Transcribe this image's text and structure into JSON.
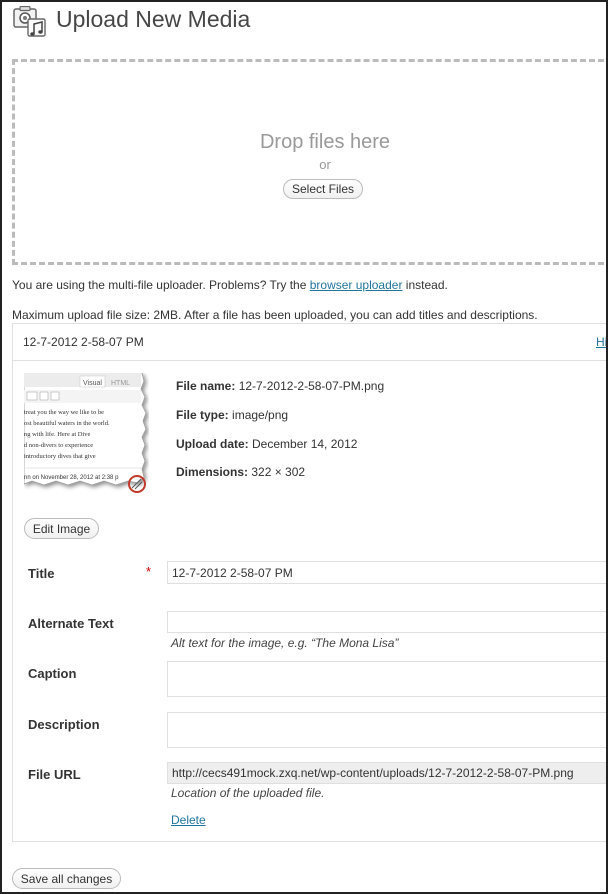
{
  "header": {
    "title": "Upload New Media",
    "icon": "media-library-icon"
  },
  "uploader": {
    "drop_text": "Drop files here",
    "or_text": "or",
    "select_label": "Select Files"
  },
  "notes": {
    "multi_prefix": "You are using the multi-file uploader. Problems? Try the",
    "browser_link": "browser uploader",
    "multi_suffix": "instead.",
    "max_size": "Maximum upload file size: 2MB. After a file has been uploaded, you can add titles and descriptions."
  },
  "media_item": {
    "filename": "12-7-2012 2-58-07 PM",
    "hide_link": "Hi",
    "thumbnail": {
      "tab_visual": "Visual",
      "tab_html": "HTML",
      "lines": [
        "treat you the way we like to be",
        "ost beautiful waters in the world.",
        "ng with life. Here at Dive",
        "d non-divers to experience",
        "introductory dives that give"
      ],
      "footer": "nn on November 28, 2012 at 2:38 p"
    },
    "meta": {
      "file_name_label": "File name:",
      "file_name": "12-7-2012-2-58-07-PM.png",
      "file_type_label": "File type:",
      "file_type": "image/png",
      "upload_date_label": "Upload date:",
      "upload_date": "December 14, 2012",
      "dimensions_label": "Dimensions:",
      "dimensions": "322 × 302"
    },
    "edit_image_label": "Edit Image",
    "fields": {
      "title_label": "Title",
      "title_required": "*",
      "title_value": "12-7-2012 2-58-07 PM",
      "alt_label": "Alternate Text",
      "alt_value": "",
      "alt_help": "Alt text for the image, e.g. “The Mona Lisa”",
      "caption_label": "Caption",
      "caption_value": "",
      "description_label": "Description",
      "description_value": "",
      "url_label": "File URL",
      "url_value": "http://cecs491mock.zxq.net/wp-content/uploads/12-7-2012-2-58-07-PM.png",
      "url_help": "Location of the uploaded file.",
      "delete_label": "Delete"
    }
  },
  "footer": {
    "save_label": "Save all changes"
  },
  "colors": {
    "link": "#21759b",
    "required": "#cc0000",
    "border": "#dfdfdf"
  }
}
